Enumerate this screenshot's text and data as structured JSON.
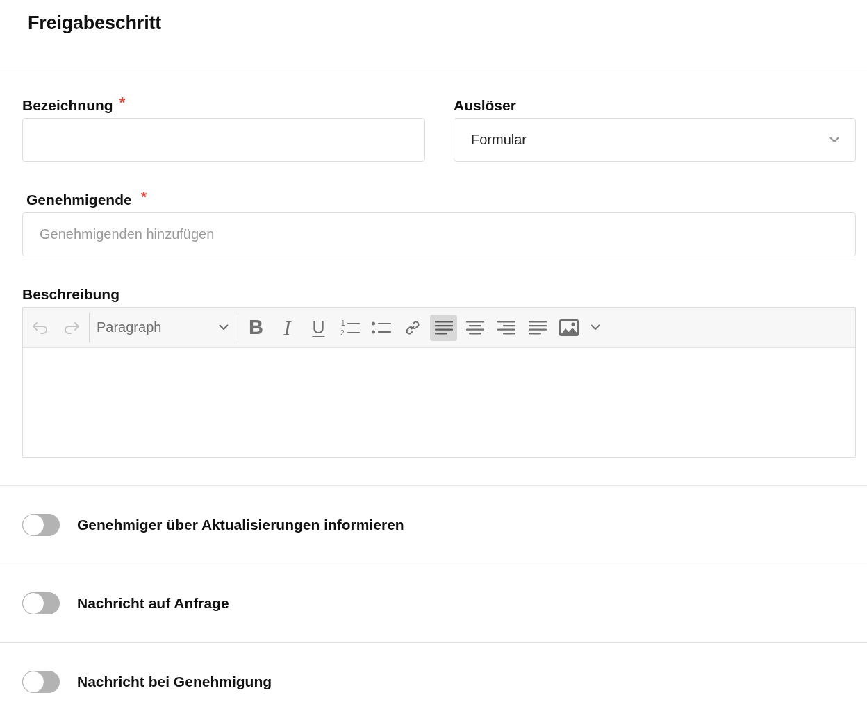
{
  "header": {
    "title": "Freigabeschritt"
  },
  "form": {
    "name": {
      "label": "Bezeichnung",
      "required_mark": "*"
    },
    "trigger": {
      "label": "Auslöser",
      "value": "Formular"
    },
    "approvers": {
      "label": "Genehmigende",
      "required_mark": "*",
      "placeholder": "Genehmigenden hinzufügen"
    },
    "description": {
      "label": "Beschreibung",
      "toolbar": {
        "history": [
          {
            "kind": "undo",
            "disabled": true
          },
          {
            "kind": "redo",
            "disabled": true
          }
        ],
        "block_format": "Paragraph",
        "tools": [
          {
            "kind": "bold",
            "glyph": "B",
            "active": false
          },
          {
            "kind": "italic",
            "glyph": "I",
            "active": false
          },
          {
            "kind": "underline",
            "glyph": "U",
            "active": false
          },
          {
            "kind": "ordered_list",
            "numbers": [
              "1",
              "2"
            ],
            "active": false
          },
          {
            "kind": "bullet_list",
            "active": false
          },
          {
            "kind": "link",
            "active": false
          },
          {
            "kind": "align_left",
            "active": true
          },
          {
            "kind": "align_center",
            "active": false
          },
          {
            "kind": "align_right",
            "active": false
          },
          {
            "kind": "align_justify",
            "active": false
          },
          {
            "kind": "image",
            "active": false
          },
          {
            "kind": "dropdown",
            "active": false
          }
        ]
      }
    }
  },
  "toggles": [
    {
      "label": "Genehmiger über Aktualisierungen informieren",
      "on": false
    },
    {
      "label": "Nachricht auf Anfrage",
      "on": false
    },
    {
      "label": "Nachricht bei Genehmigung",
      "on": false
    }
  ]
}
